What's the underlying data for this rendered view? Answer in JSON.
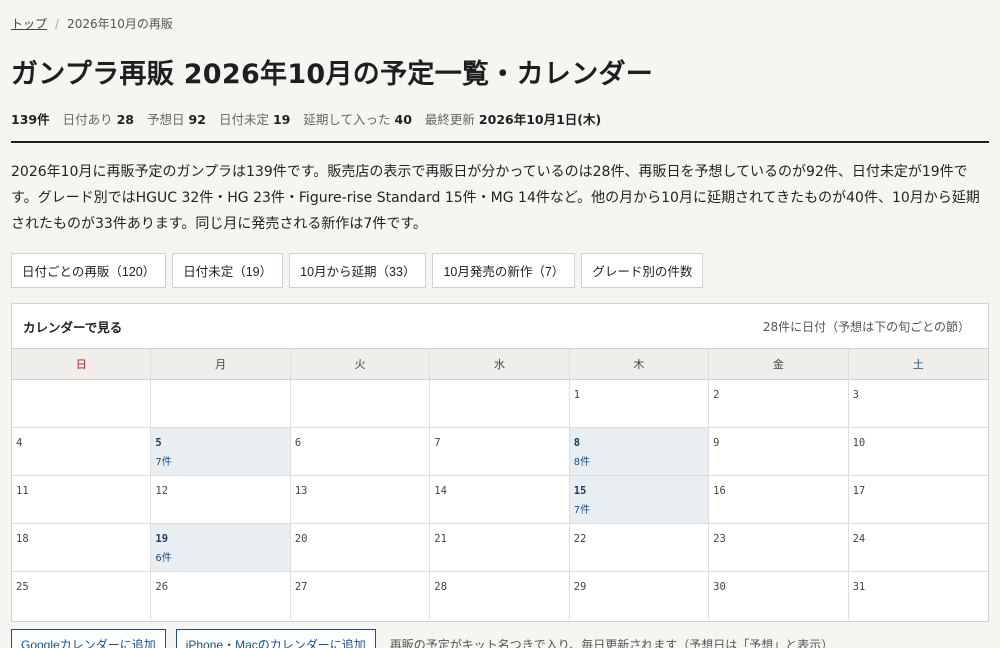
{
  "breadcrumb": {
    "home": "トップ",
    "current": "2026年10月の再販"
  },
  "page_title": "ガンプラ再販 2026年10月の予定一覧・カレンダー",
  "stats": {
    "total": "139件",
    "dated_label": "日付あり",
    "dated_value": "28",
    "predicted_label": "予想日",
    "predicted_value": "92",
    "undated_label": "日付未定",
    "undated_value": "19",
    "delayed_in_label": "延期して入った",
    "delayed_in_value": "40",
    "updated_label": "最終更新",
    "updated_value": "2026年10月1日(木)"
  },
  "intro": "2026年10月に再販予定のガンプラは139件です。販売店の表示で再販日が分かっているのは28件、再販日を予想しているのが92件、日付未定が19件です。グレード別ではHGUC 32件・HG 23件・Figure-rise Standard 15件・MG 14件など。他の月から10月に延期されてきたものが40件、10月から延期されたものが33件あります。同じ月に発売される新作は7件です。",
  "buttons": [
    "日付ごとの再販（120）",
    "日付未定（19）",
    "10月から延期（33）",
    "10月発売の新作（7）",
    "グレード別の件数"
  ],
  "calendar": {
    "title": "カレンダーで見る",
    "note": "28件に日付（予想は下の旬ごとの節）",
    "weekdays": [
      "日",
      "月",
      "火",
      "水",
      "木",
      "金",
      "土"
    ],
    "weeks": [
      [
        {
          "d": ""
        },
        {
          "d": ""
        },
        {
          "d": ""
        },
        {
          "d": ""
        },
        {
          "d": "1"
        },
        {
          "d": "2"
        },
        {
          "d": "3"
        }
      ],
      [
        {
          "d": "4"
        },
        {
          "d": "5",
          "c": "7件"
        },
        {
          "d": "6"
        },
        {
          "d": "7"
        },
        {
          "d": "8",
          "c": "8件"
        },
        {
          "d": "9"
        },
        {
          "d": "10"
        }
      ],
      [
        {
          "d": "11"
        },
        {
          "d": "12"
        },
        {
          "d": "13"
        },
        {
          "d": "14"
        },
        {
          "d": "15",
          "c": "7件"
        },
        {
          "d": "16"
        },
        {
          "d": "17"
        }
      ],
      [
        {
          "d": "18"
        },
        {
          "d": "19",
          "c": "6件"
        },
        {
          "d": "20"
        },
        {
          "d": "21"
        },
        {
          "d": "22"
        },
        {
          "d": "23"
        },
        {
          "d": "24"
        }
      ],
      [
        {
          "d": "25"
        },
        {
          "d": "26"
        },
        {
          "d": "27"
        },
        {
          "d": "28"
        },
        {
          "d": "29"
        },
        {
          "d": "30"
        },
        {
          "d": "31"
        }
      ]
    ]
  },
  "bottom": {
    "google": "Googleカレンダーに追加",
    "apple": "iPhone・Macのカレンダーに追加",
    "note": "再販の予定がキット名つきで入り、毎日更新されます（予想日は「予想」と表示）"
  }
}
